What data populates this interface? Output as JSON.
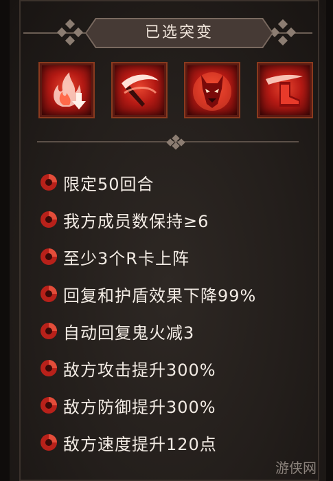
{
  "panel": {
    "title": "已选突变"
  },
  "mutations": [
    {
      "name": "flame-down-icon"
    },
    {
      "name": "scythe-slash-icon"
    },
    {
      "name": "demon-mask-icon"
    },
    {
      "name": "crimson-boot-icon"
    }
  ],
  "rules": [
    {
      "text": "限定50回合"
    },
    {
      "text": "我方成员数保持≥6"
    },
    {
      "text": "至少3个R卡上阵"
    },
    {
      "text": "回复和护盾效果下降99%"
    },
    {
      "text": "自动回复鬼火减3"
    },
    {
      "text": "敌方攻击提升300%"
    },
    {
      "text": "敌方防御提升300%"
    },
    {
      "text": "敌方速度提升120点"
    }
  ],
  "watermark": "游侠网",
  "colors": {
    "accent_red": "#c8231a",
    "title_text": "#f1e6dc",
    "rule_text": "#f2ebe4",
    "banner": "#463a35"
  }
}
